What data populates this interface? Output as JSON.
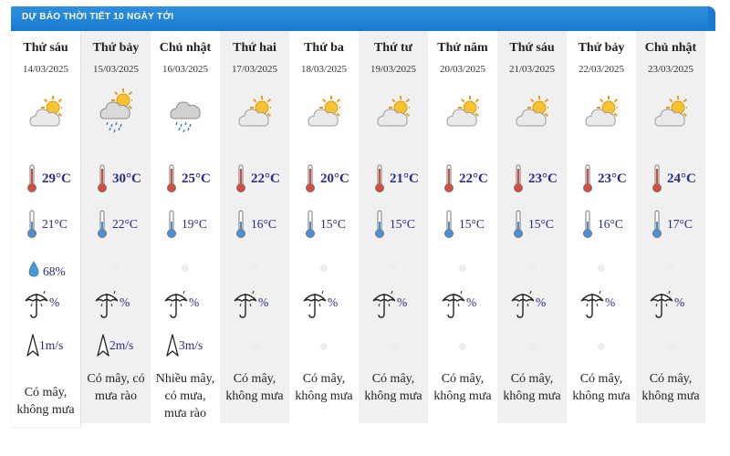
{
  "header": {
    "title": "DỰ BÁO THỜI TIẾT 10 NGÀY TỚI"
  },
  "days": [
    {
      "name": "Thứ sáu",
      "date": "14/03/2025",
      "icon": "partly-cloudy-sun",
      "tmax": "29°C",
      "tmin": "21°C",
      "humidity": "68%",
      "rain": "%",
      "wind": "1m/s",
      "desc": "Có mây, không mưa"
    },
    {
      "name": "Thứ bảy",
      "date": "15/03/2025",
      "icon": "rain-showers-sun",
      "tmax": "30°C",
      "tmin": "22°C",
      "humidity": "",
      "rain": "%",
      "wind": "2m/s",
      "desc": "Có mây, có mưa rào"
    },
    {
      "name": "Chủ nhật",
      "date": "16/03/2025",
      "icon": "rain-cloud",
      "tmax": "25°C",
      "tmin": "19°C",
      "humidity": "",
      "rain": "%",
      "wind": "3m/s",
      "desc": "Nhiều mây, có mưa, mưa rào"
    },
    {
      "name": "Thứ hai",
      "date": "17/03/2025",
      "icon": "partly-cloudy-sun",
      "tmax": "22°C",
      "tmin": "16°C",
      "humidity": "",
      "rain": "%",
      "wind": "",
      "desc": "Có mây, không mưa"
    },
    {
      "name": "Thứ ba",
      "date": "18/03/2025",
      "icon": "partly-cloudy-sun",
      "tmax": "20°C",
      "tmin": "15°C",
      "humidity": "",
      "rain": "%",
      "wind": "",
      "desc": "Có mây, không mưa"
    },
    {
      "name": "Thứ tư",
      "date": "19/03/2025",
      "icon": "partly-cloudy-sun",
      "tmax": "21°C",
      "tmin": "15°C",
      "humidity": "",
      "rain": "%",
      "wind": "",
      "desc": "Có mây, không mưa"
    },
    {
      "name": "Thứ năm",
      "date": "20/03/2025",
      "icon": "partly-cloudy-sun",
      "tmax": "22°C",
      "tmin": "15°C",
      "humidity": "",
      "rain": "%",
      "wind": "",
      "desc": "Có mây, không mưa"
    },
    {
      "name": "Thứ sáu",
      "date": "21/03/2025",
      "icon": "partly-cloudy-sun",
      "tmax": "23°C",
      "tmin": "15°C",
      "humidity": "",
      "rain": "%",
      "wind": "",
      "desc": "Có mây, không mưa"
    },
    {
      "name": "Thứ bảy",
      "date": "22/03/2025",
      "icon": "partly-cloudy-sun",
      "tmax": "23°C",
      "tmin": "16°C",
      "humidity": "",
      "rain": "%",
      "wind": "",
      "desc": "Có mây, không mưa"
    },
    {
      "name": "Chủ nhật",
      "date": "23/03/2025",
      "icon": "partly-cloudy-sun",
      "tmax": "24°C",
      "tmin": "17°C",
      "humidity": "",
      "rain": "%",
      "wind": "",
      "desc": "Có mây, không mưa"
    }
  ],
  "colors": {
    "header_bg": "#1a7ad2",
    "value_text": "#2a2a8a",
    "thermo_red": "#d84a3a",
    "thermo_blue": "#4a8fd8",
    "shaded_col": "#f0f0f1"
  }
}
